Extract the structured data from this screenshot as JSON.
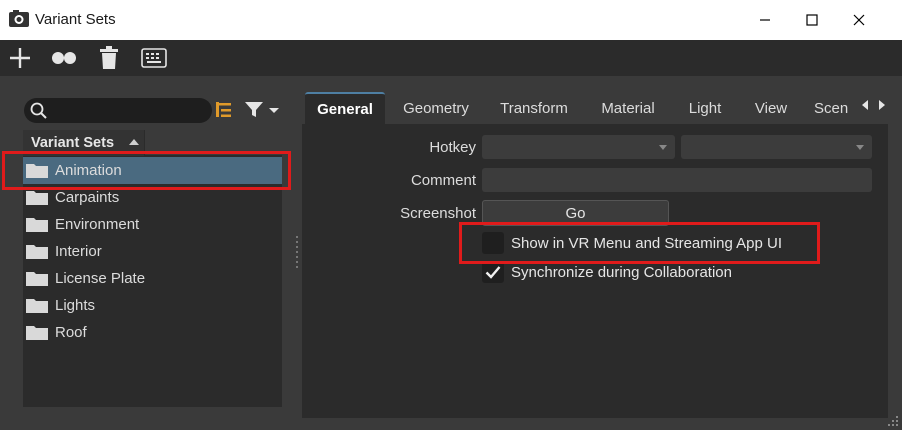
{
  "window": {
    "title": "Variant Sets",
    "controls": [
      "minimize-icon",
      "maximize-icon",
      "close-icon"
    ]
  },
  "toolbar": {
    "buttons": [
      {
        "name": "add",
        "icon": "plus-icon"
      },
      {
        "name": "variants",
        "icon": "two-circles-icon"
      },
      {
        "name": "delete",
        "icon": "trash-icon"
      },
      {
        "name": "keyboard",
        "icon": "keyboard-icon"
      }
    ]
  },
  "search": {
    "placeholder": "",
    "value": ""
  },
  "list": {
    "header": "Variant Sets",
    "items": [
      {
        "label": "Animation",
        "selected": true
      },
      {
        "label": "Carpaints",
        "selected": false
      },
      {
        "label": "Environment",
        "selected": false
      },
      {
        "label": "Interior",
        "selected": false
      },
      {
        "label": "License Plate",
        "selected": false
      },
      {
        "label": "Lights",
        "selected": false
      },
      {
        "label": "Roof",
        "selected": false
      }
    ]
  },
  "tabs": [
    {
      "label": "General",
      "active": true
    },
    {
      "label": "Geometry",
      "active": false
    },
    {
      "label": "Transform",
      "active": false
    },
    {
      "label": "Material",
      "active": false
    },
    {
      "label": "Light",
      "active": false
    },
    {
      "label": "View",
      "active": false
    },
    {
      "label": "Scen",
      "active": false
    }
  ],
  "general": {
    "hotkey_label": "Hotkey",
    "comment_label": "Comment",
    "comment_value": "",
    "screenshot_label": "Screenshot",
    "go_label": "Go",
    "show_vr_label": "Show in VR Menu and Streaming App UI",
    "show_vr_checked": false,
    "sync_label": "Synchronize during Collaboration",
    "sync_checked": true
  },
  "colors": {
    "highlight": "#e01b1b",
    "selection": "#4a6a80",
    "active_tab_accent": "#4e7fa3"
  }
}
